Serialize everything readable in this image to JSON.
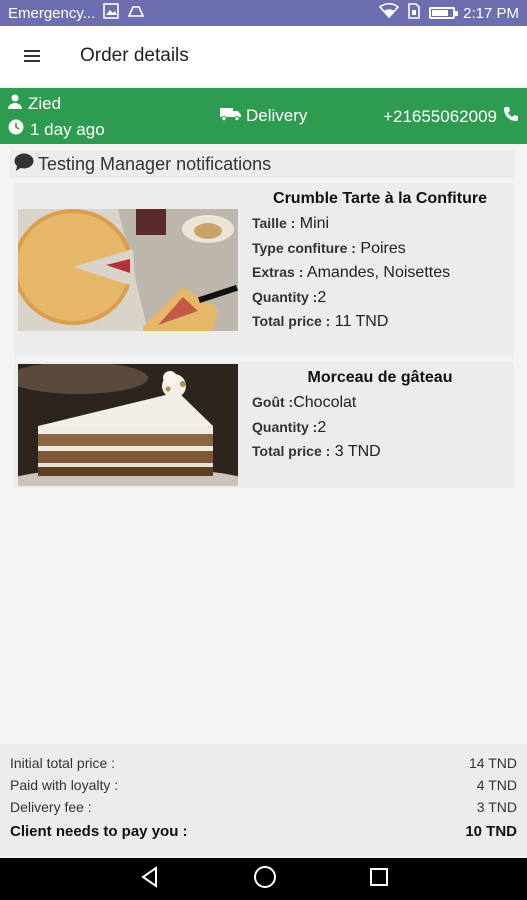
{
  "status_bar": {
    "carrier": "Emergency...",
    "time": "2:17 PM",
    "battery_level": 0.8,
    "icons": [
      "gallery-icon",
      "cast-icon",
      "wifi-icon",
      "sim-icon",
      "battery-icon"
    ]
  },
  "app_bar": {
    "title": "Order details",
    "menu_icon": "hamburger-menu-icon"
  },
  "order": {
    "customer": "Zied",
    "time_ago": "1 day ago",
    "mode": "Delivery",
    "phone": "+21655062009",
    "colors": {
      "header": "#2e9c50"
    }
  },
  "notification": "Testing Manager notifications",
  "items": [
    {
      "name": "Crumble Tarte à la Confiture",
      "attrs": [
        {
          "key": "Taille :",
          "value": " Mini"
        },
        {
          "key": "Type confiture :",
          "value": " Poires"
        },
        {
          "key": "Extras :",
          "value": " Amandes, Noisettes"
        },
        {
          "key": "Quantity :",
          "value": "2"
        },
        {
          "key": "Total price :",
          "value": " 11 TND"
        }
      ]
    },
    {
      "name": "Morceau de gâteau",
      "attrs": [
        {
          "key": "Goût :",
          "value": "Chocolat"
        },
        {
          "key": "Quantity :",
          "value": "2"
        },
        {
          "key": "Total price :",
          "value": " 3 TND"
        }
      ]
    }
  ],
  "summary": {
    "rows": [
      {
        "label": "Initial total price :",
        "value": "14 TND"
      },
      {
        "label": "Paid with loyalty :",
        "value": "4 TND"
      },
      {
        "label": "Delivery fee :",
        "value": "3 TND"
      }
    ],
    "total": {
      "label": "Client needs to pay you :",
      "value": "10 TND"
    }
  }
}
